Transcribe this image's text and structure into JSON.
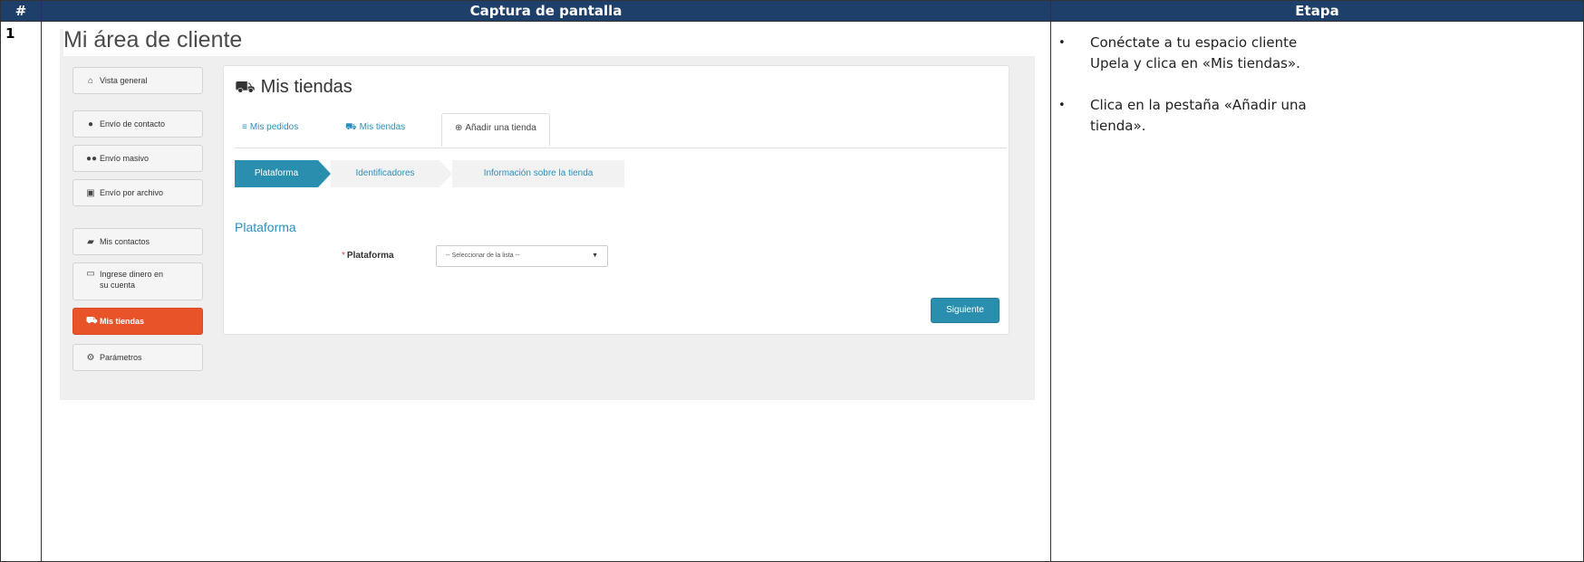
{
  "table": {
    "headers": [
      "#",
      "Captura de pantalla",
      "Etapa"
    ],
    "row_number": "1"
  },
  "screenshot": {
    "area_title": "Mi área de cliente",
    "sidebar": [
      {
        "icon": "home-icon",
        "label": "Vista general"
      },
      {
        "icon": "user-icon",
        "label": "Envío de contacto"
      },
      {
        "icon": "users-icon",
        "label": "Envío masivo"
      },
      {
        "icon": "floppy-icon",
        "label": "Envío por archivo"
      },
      {
        "icon": "book-icon",
        "label": "Mis contactos"
      },
      {
        "icon": "card-icon",
        "label_line1": "Ingrese dinero en",
        "label_line2": "su cuenta"
      },
      {
        "icon": "cart-icon",
        "label": "Mis tiendas",
        "active": true
      },
      {
        "icon": "gears-icon",
        "label": "Parámetros"
      }
    ],
    "panel_title": "Mis tiendas",
    "tabs": [
      {
        "icon": "list-icon",
        "label": "Mis pedidos"
      },
      {
        "icon": "cart-icon",
        "label": "Mis tiendas"
      },
      {
        "icon": "plus-circle-icon",
        "label": "Añadir una tienda",
        "active": true
      }
    ],
    "steps": [
      "Plataforma",
      "Identificadores",
      "Información sobre la tienda"
    ],
    "section_label": "Plataforma",
    "field_label": "Plataforma",
    "required_mark": "*",
    "select_value": "-- Seleccionar de la lista --",
    "next_button": "Siguiente"
  },
  "instructions": [
    {
      "line1": "Conéctate a tu espacio cliente",
      "line2": "Upela y clica en «Mis tiendas»."
    },
    {
      "line1": "Clica en la pestaña «Añadir una",
      "line2": "tienda»."
    }
  ],
  "colors": {
    "header_bg": "#1f3f6b",
    "accent": "#2a8fae",
    "active_sidebar": "#e8532a"
  }
}
